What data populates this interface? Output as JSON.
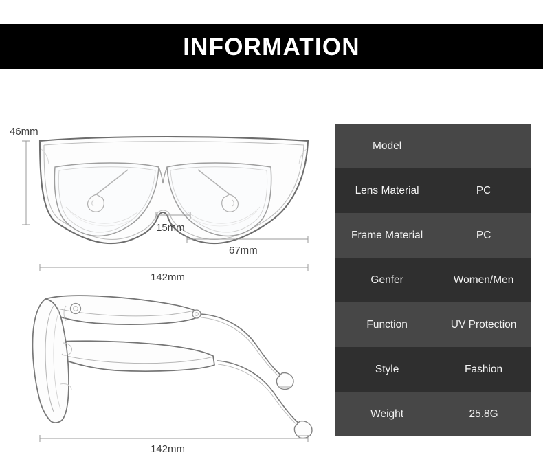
{
  "header": {
    "title": "INFORMATION",
    "background_color": "#000000",
    "text_color": "#ffffff"
  },
  "diagram": {
    "front_view_name": "sunglasses-front-view",
    "side_view_name": "sunglasses-side-view",
    "line_color": "#6e6e6e",
    "dimension_line_color": "#8c8c8c",
    "dimensions": {
      "lens_height": "46mm",
      "bridge_width": "15mm",
      "lens_width": "67mm",
      "frame_width_front": "142mm",
      "temple_length_side": "142mm"
    }
  },
  "spec_table": {
    "row_color_light": "#474747",
    "row_color_dark": "#2f2f2f",
    "text_color": "#f2f2f2",
    "rows": [
      {
        "label": "Model",
        "value": ""
      },
      {
        "label": "Lens Material",
        "value": "PC"
      },
      {
        "label": "Frame Material",
        "value": "PC"
      },
      {
        "label": "Genfer",
        "value": "Women/Men"
      },
      {
        "label": "Function",
        "value": "UV Protection"
      },
      {
        "label": "Style",
        "value": "Fashion"
      },
      {
        "label": "Weight",
        "value": "25.8G"
      }
    ]
  }
}
